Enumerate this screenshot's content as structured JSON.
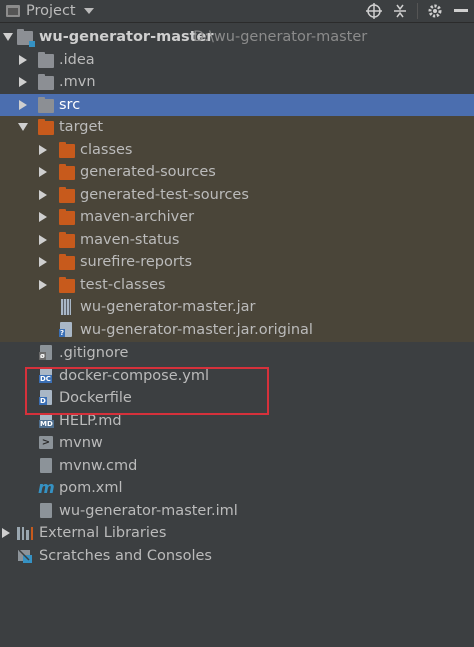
{
  "header": {
    "title": "Project"
  },
  "tree": {
    "root": {
      "label": "wu-generator-master",
      "path": "D:\\wu-generator-master"
    },
    "items": [
      {
        "label": ".idea"
      },
      {
        "label": ".mvn"
      },
      {
        "label": "src"
      },
      {
        "label": "target"
      },
      {
        "label": "classes"
      },
      {
        "label": "generated-sources"
      },
      {
        "label": "generated-test-sources"
      },
      {
        "label": "maven-archiver"
      },
      {
        "label": "maven-status"
      },
      {
        "label": "surefire-reports"
      },
      {
        "label": "test-classes"
      },
      {
        "label": "wu-generator-master.jar"
      },
      {
        "label": "wu-generator-master.jar.original"
      },
      {
        "label": ".gitignore"
      },
      {
        "label": "docker-compose.yml"
      },
      {
        "label": "Dockerfile"
      },
      {
        "label": "HELP.md"
      },
      {
        "label": "mvnw"
      },
      {
        "label": "mvnw.cmd"
      },
      {
        "label": "pom.xml"
      },
      {
        "label": "wu-generator-master.iml"
      }
    ],
    "external_libraries": "External Libraries",
    "scratches": "Scratches and Consoles"
  },
  "colors": {
    "selection": "#4b6eaf",
    "excluded_bg": "#4a4539",
    "highlight_box": "#d6313b"
  }
}
